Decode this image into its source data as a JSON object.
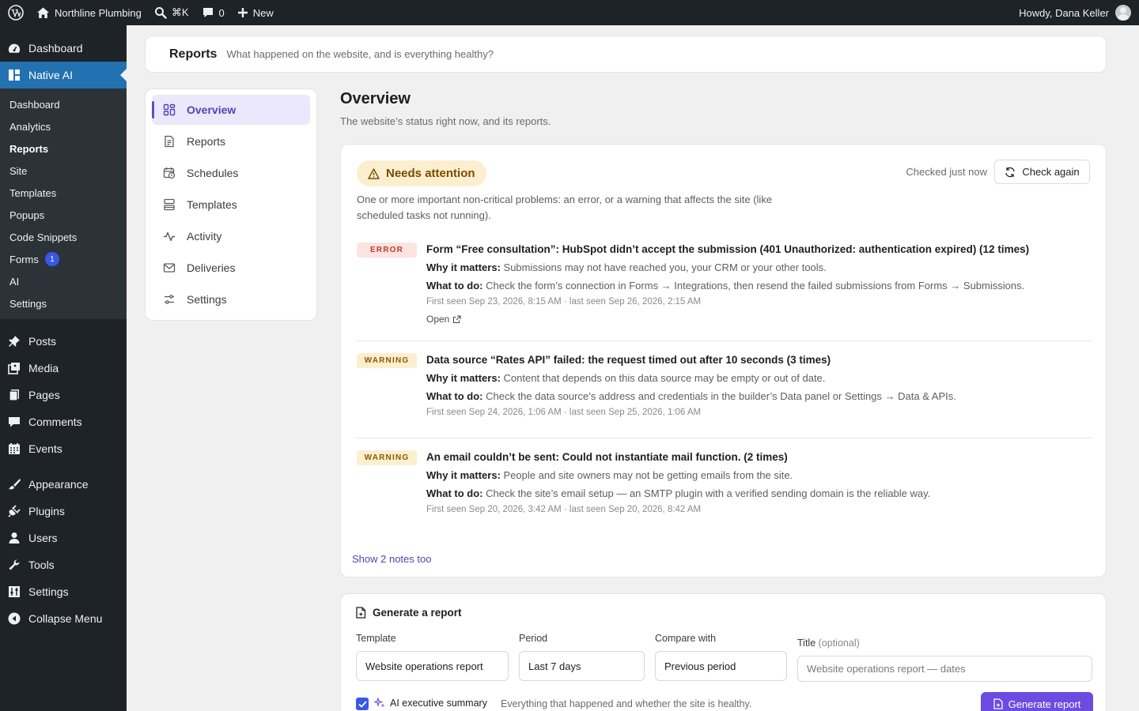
{
  "adminbar": {
    "site_name": "Northline Plumbing",
    "search_shortcut": "⌘K",
    "comments_count": "0",
    "new_label": "New",
    "howdy": "Howdy, Dana Keller"
  },
  "sidebar": {
    "dashboard": "Dashboard",
    "native_ai": "Native AI",
    "sub_items": [
      {
        "label": "Dashboard"
      },
      {
        "label": "Analytics"
      },
      {
        "label": "Reports"
      },
      {
        "label": "Site"
      },
      {
        "label": "Templates"
      },
      {
        "label": "Popups"
      },
      {
        "label": "Code Snippets"
      },
      {
        "label": "Forms",
        "badge": "1"
      },
      {
        "label": "AI"
      },
      {
        "label": "Settings"
      }
    ],
    "menu": [
      {
        "label": "Posts"
      },
      {
        "label": "Media"
      },
      {
        "label": "Pages"
      },
      {
        "label": "Comments"
      },
      {
        "label": "Events"
      },
      {
        "label": "Appearance"
      },
      {
        "label": "Plugins"
      },
      {
        "label": "Users"
      },
      {
        "label": "Tools"
      },
      {
        "label": "Settings"
      },
      {
        "label": "Collapse Menu"
      }
    ]
  },
  "header": {
    "title": "Reports",
    "subtitle": "What happened on the website, and is everything healthy?"
  },
  "nav": [
    {
      "label": "Overview"
    },
    {
      "label": "Reports"
    },
    {
      "label": "Schedules"
    },
    {
      "label": "Templates"
    },
    {
      "label": "Activity"
    },
    {
      "label": "Deliveries"
    },
    {
      "label": "Settings"
    }
  ],
  "overview": {
    "title": "Overview",
    "subtitle": "The website’s status right now, and its reports."
  },
  "status": {
    "badge": "Needs attention",
    "checked": "Checked just now",
    "check_again": "Check again",
    "description": "One or more important non-critical problems: an error, or a warning that affects the site (like scheduled tasks not running).",
    "why_label": "Why it matters:",
    "todo_label": "What to do:",
    "show_notes": "Show 2 notes too",
    "issues": [
      {
        "level": "ERROR",
        "title": "Form “Free consultation”: HubSpot didn’t accept the submission (401 Unauthorized: authentication expired) (12 times)",
        "why": "Submissions may not have reached you, your CRM or your other tools.",
        "todo": "Check the form’s connection in Forms → Integrations, then resend the failed submissions from Forms → Submissions.",
        "meta": "First seen Sep 23, 2026, 8:15 AM · last seen Sep 26, 2026, 2:15 AM",
        "open": "Open"
      },
      {
        "level": "WARNING",
        "title": "Data source “Rates API” failed: the request timed out after 10 seconds (3 times)",
        "why": "Content that depends on this data source may be empty or out of date.",
        "todo": "Check the data source’s address and credentials in the builder’s Data panel or Settings → Data & APIs.",
        "meta": "First seen Sep 24, 2026, 1:06 AM · last seen Sep 25, 2026, 1:06 AM"
      },
      {
        "level": "WARNING",
        "title": "An email couldn’t be sent: Could not instantiate mail function. (2 times)",
        "why": "People and site owners may not be getting emails from the site.",
        "todo": "Check the site’s email setup — an SMTP plugin with a verified sending domain is the reliable way.",
        "meta": "First seen Sep 20, 2026, 3:42 AM · last seen Sep 20, 2026, 8:42 AM"
      }
    ]
  },
  "generate": {
    "title": "Generate a report",
    "template_label": "Template",
    "template_value": "Website operations report",
    "period_label": "Period",
    "period_value": "Last 7 days",
    "compare_label": "Compare with",
    "compare_value": "Previous period",
    "title_label": "Title",
    "title_optional": "(optional)",
    "title_placeholder": "Website operations report — dates",
    "ai_summary_label": "AI executive summary",
    "ai_summary_checked": true,
    "ai_summary_desc": "Everything that happened and whether the site is healthy.",
    "button": "Generate report"
  },
  "colors": {
    "admin_bg": "#1d2327",
    "admin_active": "#2271b1",
    "accent": "#6c4ce0",
    "attention_bg": "#fcefcf",
    "error": "#c0392b"
  }
}
